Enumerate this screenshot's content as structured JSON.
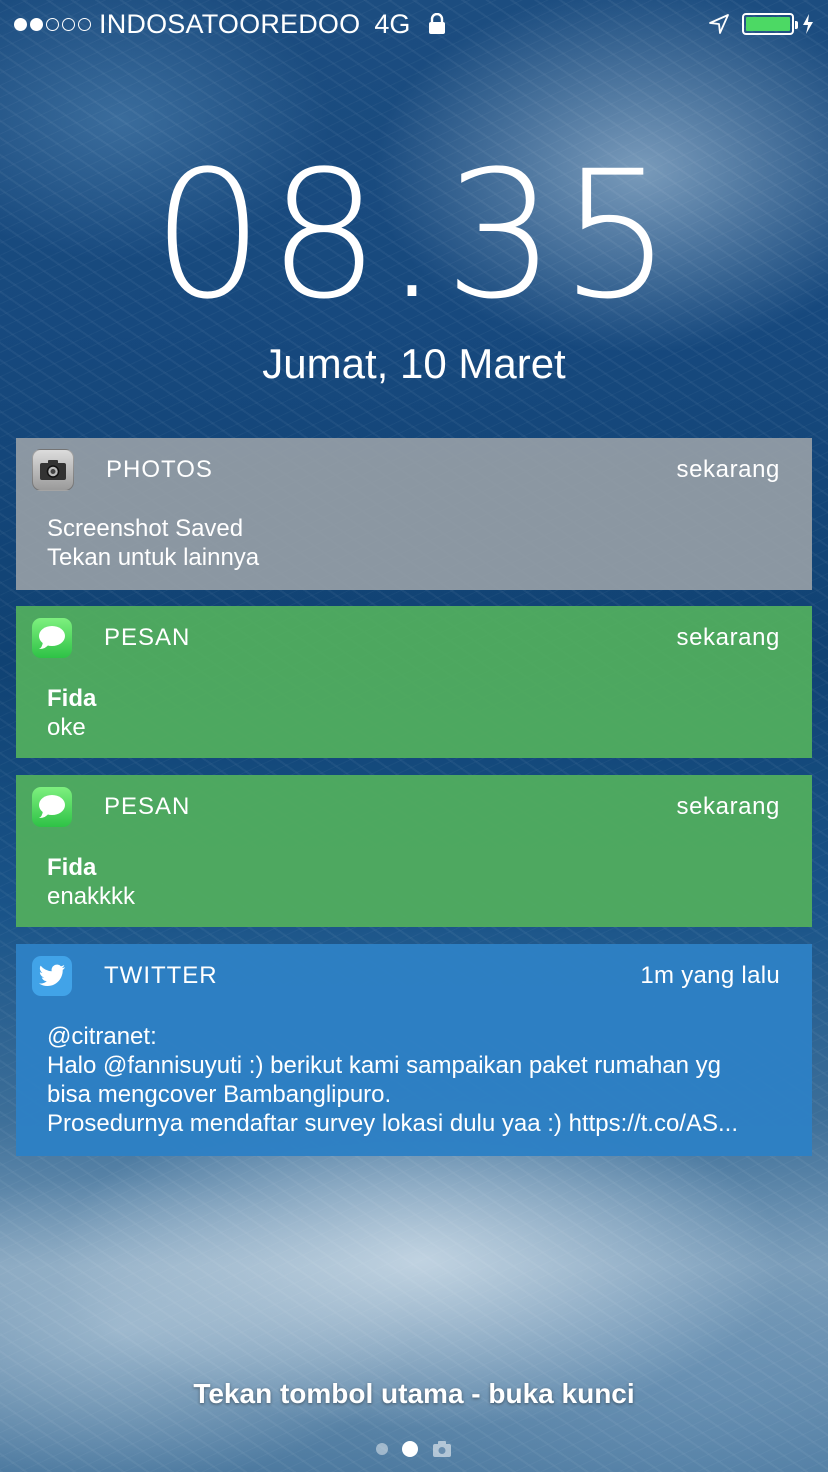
{
  "status_bar": {
    "signal_filled": 2,
    "signal_total": 5,
    "carrier": "INDOSATOOREDOO",
    "network": "4G",
    "icons": [
      "lock-icon",
      "location-arrow-icon",
      "battery-icon",
      "charging-bolt-icon"
    ],
    "battery_level": 1.0,
    "battery_color": "#4cd964"
  },
  "lock_screen": {
    "time_hours": "08",
    "time_separator": ".",
    "time_minutes": "35",
    "date": "Jumat, 10 Maret"
  },
  "notifications": [
    {
      "app": "PHOTOS",
      "icon": "camera-icon",
      "time": "sekarang",
      "title": "Screenshot Saved",
      "body": "Tekan untuk lainnya",
      "color": "#969ea6"
    },
    {
      "app": "PESAN",
      "icon": "messages-icon",
      "time": "sekarang",
      "title": "Fida",
      "body": "oke",
      "color": "#50ac5f"
    },
    {
      "app": "PESAN",
      "icon": "messages-icon",
      "time": "sekarang",
      "title": "Fida",
      "body": "enakkkk",
      "color": "#50ac5f"
    },
    {
      "app": "TWITTER",
      "icon": "twitter-bird-icon",
      "time": "1m yang lalu",
      "title": "@citranet:",
      "body_lines": [
        "Halo @fannisuyuti :) berikut kami sampaikan paket rumahan yg",
        "bisa mengcover Bambanglipuro.",
        "Prosedurnya mendaftar survey lokasi dulu yaa :) https://t.co/AS..."
      ],
      "color": "#2d80c4"
    }
  ],
  "footer": {
    "unlock_hint": "Tekan tombol utama - buka kunci",
    "page_count": 2,
    "active_page": 1,
    "camera_page_icon": "camera-icon"
  }
}
